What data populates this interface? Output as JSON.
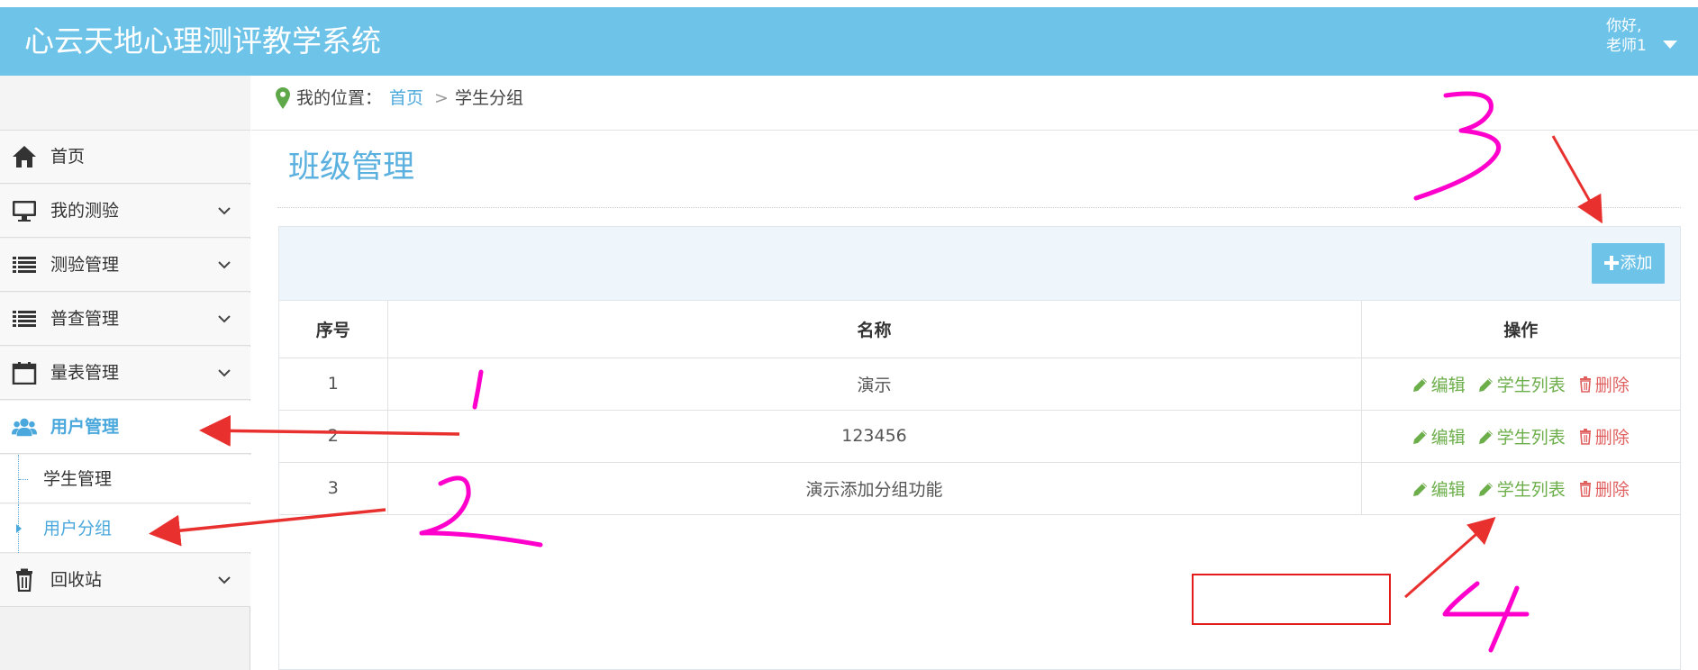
{
  "header": {
    "app_title": "心云天地心理测评教学系统",
    "greeting": "你好,",
    "user_name": "老师1"
  },
  "breadcrumb": {
    "label": "我的位置：",
    "home": "首页",
    "separator": ">",
    "current": "学生分组"
  },
  "sidebar": {
    "items": [
      {
        "label": "首页",
        "icon": "home-icon"
      },
      {
        "label": "我的测验",
        "icon": "monitor-icon"
      },
      {
        "label": "测验管理",
        "icon": "list-icon"
      },
      {
        "label": "普查管理",
        "icon": "list-icon"
      },
      {
        "label": "量表管理",
        "icon": "calendar-icon"
      },
      {
        "label": "用户管理",
        "icon": "users-icon"
      },
      {
        "label": "回收站",
        "icon": "trash-icon"
      }
    ],
    "subitems": [
      {
        "label": "学生管理"
      },
      {
        "label": "用户分组"
      }
    ]
  },
  "main": {
    "page_title": "班级管理",
    "add_label": "添加",
    "table": {
      "columns": [
        "序号",
        "名称",
        "操作"
      ],
      "rows": [
        {
          "index": "1",
          "name": "演示"
        },
        {
          "index": "2",
          "name": "123456"
        },
        {
          "index": "3",
          "name": "演示添加分组功能"
        }
      ],
      "actions": {
        "edit": "编辑",
        "students": "学生列表",
        "delete": "删除"
      }
    }
  },
  "annotations": {
    "numbers": [
      "1",
      "2",
      "3",
      "4"
    ],
    "colors": {
      "pen": "#ff00cc",
      "arrow": "#e8312f",
      "box": "#e21b1b"
    }
  }
}
